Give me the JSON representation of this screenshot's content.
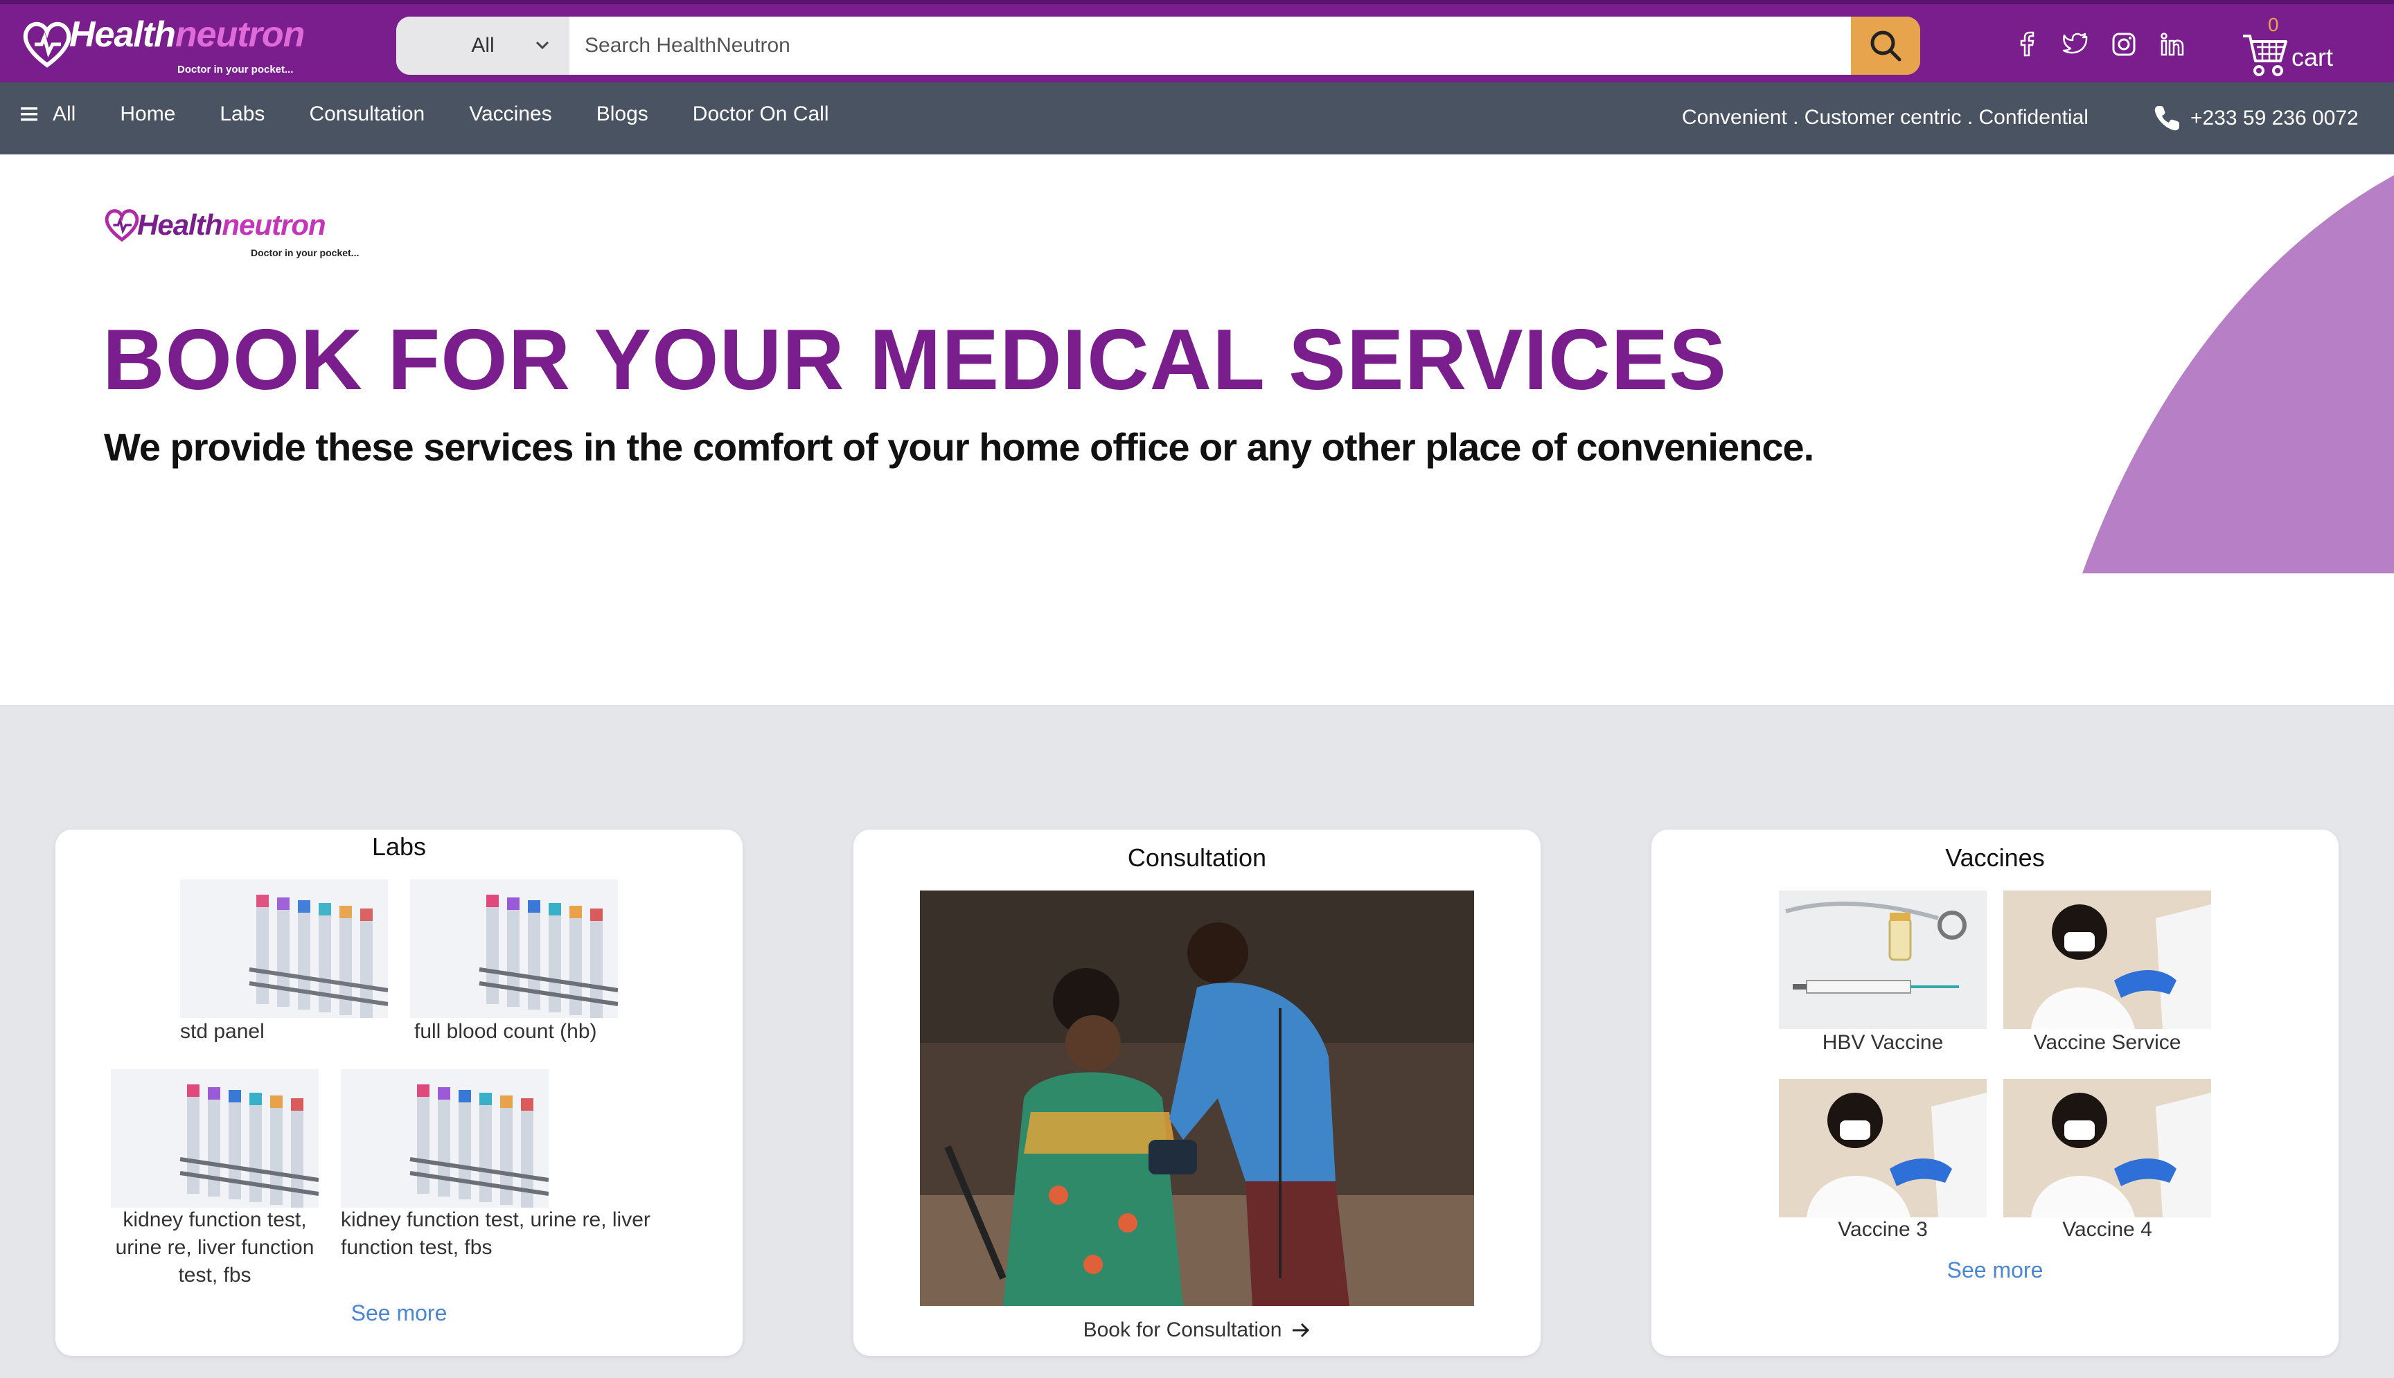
{
  "header": {
    "logo_word_main": "Health",
    "logo_word_accent": "neutron",
    "logo_tagline": "Doctor in your pocket...",
    "search": {
      "category": "All",
      "placeholder": "Search HealthNeutron"
    },
    "social_icons": [
      "facebook-icon",
      "twitter-icon",
      "instagram-icon",
      "linkedin-icon"
    ],
    "cart": {
      "count": "0",
      "label": "cart"
    }
  },
  "nav": {
    "all_label": "All",
    "links": [
      "Home",
      "Labs",
      "Consultation",
      "Vaccines",
      "Blogs",
      "Doctor On Call"
    ],
    "tagline": "Convenient . Customer centric . Confidential",
    "phone": "+233 59 236 0072"
  },
  "hero": {
    "logo_word_main": "Health",
    "logo_word_accent": "neutron",
    "logo_tagline": "Doctor in your pocket...",
    "title": "BOOK FOR YOUR MEDICAL SERVICES",
    "subtitle": "We provide these services in the comfort of your home office or any other place of convenience."
  },
  "cards": {
    "labs": {
      "title": "Labs",
      "items": [
        "std panel",
        "full blood count (hb)",
        "kidney function test, urine re, liver function test, fbs",
        "kidney function test, urine re, liver function test, fbs"
      ],
      "see_more": "See more"
    },
    "consultation": {
      "title": "Consultation",
      "book_label": "Book for Consultation"
    },
    "vaccines": {
      "title": "Vaccines",
      "items": [
        "HBV Vaccine",
        "Vaccine Service",
        "Vaccine 3",
        "Vaccine 4"
      ],
      "see_more": "See more"
    }
  },
  "colors": {
    "brand_purple": "#7b1e8d",
    "nav_gray": "#4a5361",
    "search_orange": "#e8a44c",
    "link_blue": "#4a86d4",
    "arc_lavender": "#b77fc6"
  }
}
